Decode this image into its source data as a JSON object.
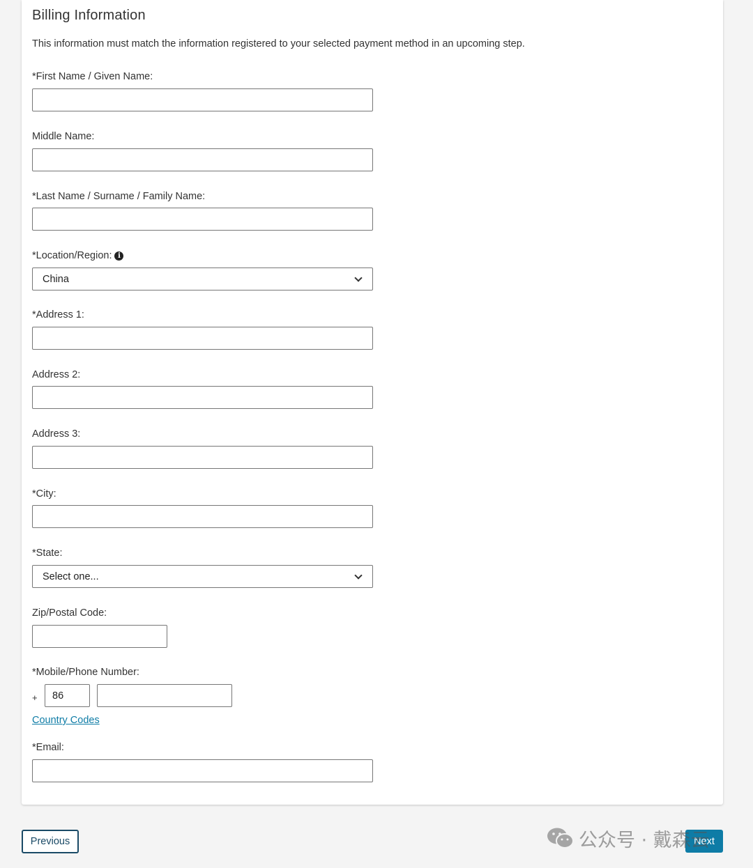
{
  "section": {
    "title": "Billing Information",
    "description": "This information must match the information registered to your selected payment method in an upcoming step."
  },
  "fields": {
    "first_name": {
      "label": "*First Name / Given Name:",
      "value": ""
    },
    "middle_name": {
      "label": "Middle Name:",
      "value": ""
    },
    "last_name": {
      "label": "*Last Name / Surname / Family Name:",
      "value": ""
    },
    "location": {
      "label": "*Location/Region:",
      "value": "China",
      "icon": "info-icon"
    },
    "address1": {
      "label": "*Address 1:",
      "value": ""
    },
    "address2": {
      "label": "Address 2:",
      "value": ""
    },
    "address3": {
      "label": "Address 3:",
      "value": ""
    },
    "city": {
      "label": "*City:",
      "value": ""
    },
    "state": {
      "label": "*State:",
      "value": "Select one..."
    },
    "zip": {
      "label": "Zip/Postal Code:",
      "value": ""
    },
    "phone": {
      "label": "*Mobile/Phone Number:",
      "prefix": "+",
      "country_code": "86",
      "number": ""
    },
    "country_codes_link": "Country Codes",
    "email": {
      "label": "*Email:",
      "value": ""
    }
  },
  "buttons": {
    "previous": "Previous",
    "next": "Next"
  },
  "watermark": {
    "text": "公众号 · 戴森云",
    "icon": "wechat-icon"
  },
  "colors": {
    "accent": "#0e7ca6",
    "prev_border": "#1a4a66",
    "background": "#f4f4f4"
  }
}
